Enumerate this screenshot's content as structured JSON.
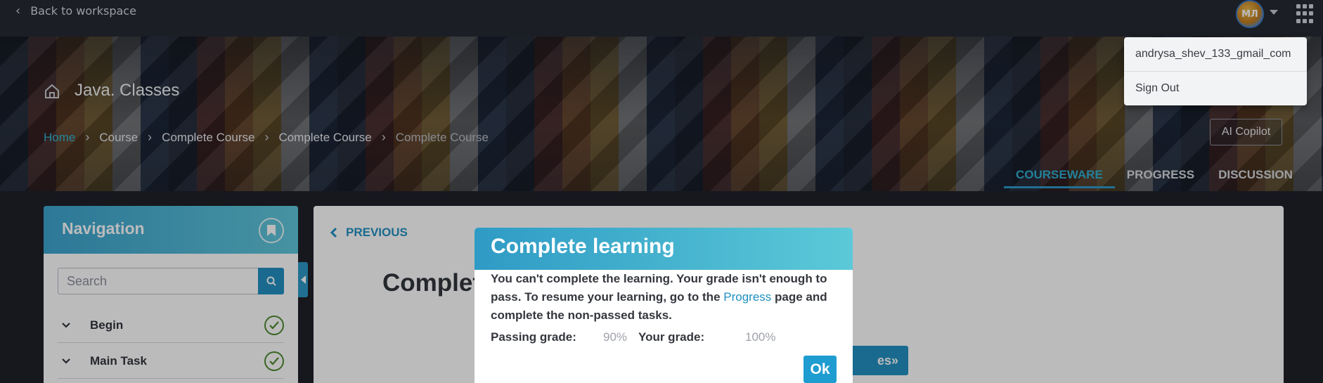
{
  "topbar": {
    "back_label": "Back to workspace",
    "avatar_initials": "МЛ"
  },
  "user_menu": {
    "items": [
      {
        "label": "andrysa_shev_133_gmail_com"
      },
      {
        "label": "Sign Out"
      }
    ]
  },
  "course": {
    "title": "Java. Classes"
  },
  "breadcrumb": [
    "Home",
    "Course",
    "Complete Course",
    "Complete Course",
    "Complete Course"
  ],
  "header_actions": {
    "ai_copilot_label": "AI Copilot"
  },
  "tabs": [
    {
      "label": "COURSEWARE",
      "active": true
    },
    {
      "label": "PROGRESS",
      "active": false
    },
    {
      "label": "DISCUSSION",
      "active": false
    }
  ],
  "navigation": {
    "title": "Navigation",
    "search_placeholder": "Search",
    "items": [
      {
        "label": "Begin",
        "completed": true
      },
      {
        "label": "Main Task",
        "completed": true
      }
    ]
  },
  "main": {
    "previous_label": "PREVIOUS",
    "unit_title": "Complete Course",
    "next_label": "es»"
  },
  "modal": {
    "title": "Complete learning",
    "message_part1": "You can't complete the learning. Your grade isn't enough to pass. To resume your learning, go to the ",
    "message_link": "Progress",
    "message_part2": " page and complete the non-passed tasks.",
    "passing_label": "Passing grade:",
    "passing_value": "90%",
    "your_label": "Your grade:",
    "your_value": "100%",
    "ok_label": "Ok"
  },
  "colors": {
    "accent": "#1f8fbf",
    "header_gradient_start": "#2f9bc5",
    "header_gradient_end": "#5cc9d8",
    "check_green": "#4c8a2a"
  }
}
